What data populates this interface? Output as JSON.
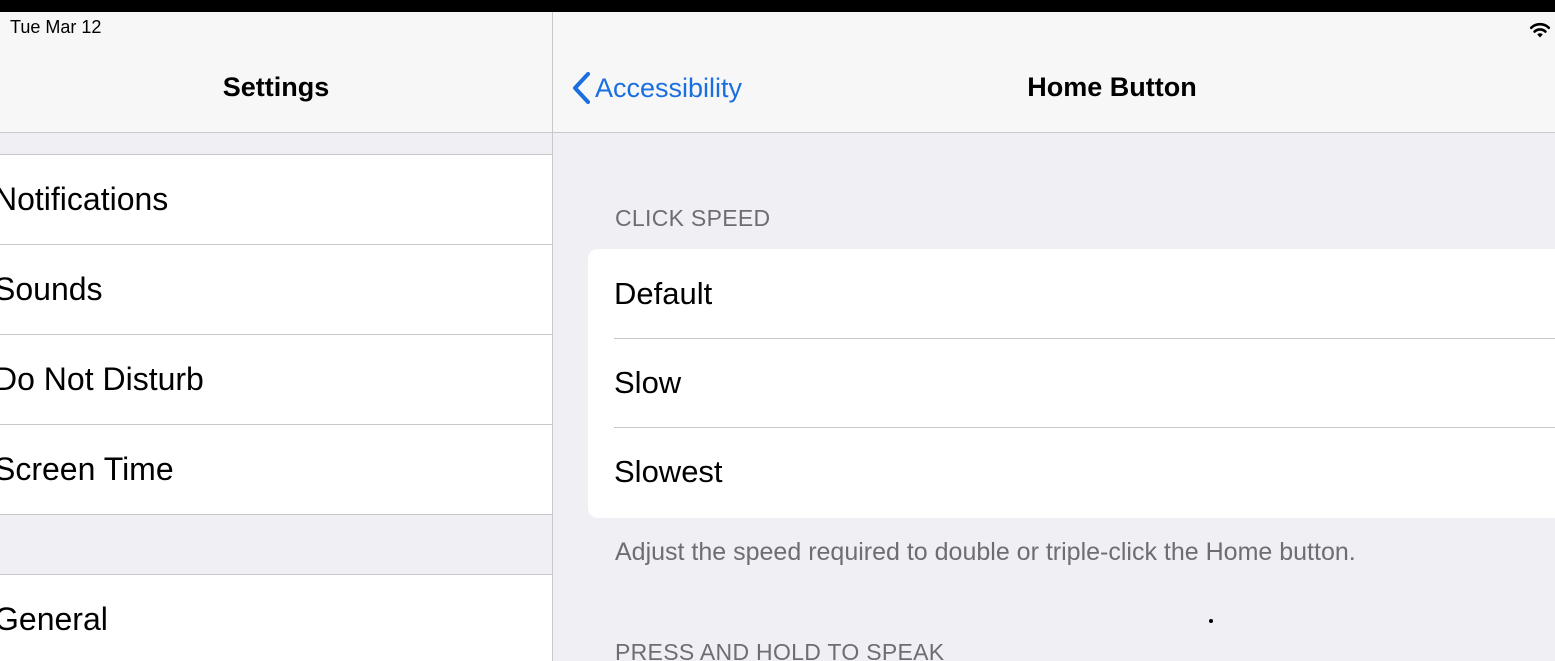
{
  "status_bar": {
    "date": "Tue Mar 12",
    "wifi_icon": "wifi-icon"
  },
  "master": {
    "title": "Settings",
    "group1": [
      {
        "label": "Notifications"
      },
      {
        "label": "Sounds"
      },
      {
        "label": "Do Not Disturb"
      },
      {
        "label": "Screen Time"
      }
    ],
    "group2": [
      {
        "label": "General"
      }
    ]
  },
  "detail": {
    "back_label": "Accessibility",
    "back_icon": "chevron-left-icon",
    "title": "Home Button",
    "click_speed": {
      "header": "CLICK SPEED",
      "options": [
        {
          "label": "Default"
        },
        {
          "label": "Slow"
        },
        {
          "label": "Slowest"
        }
      ],
      "footer": "Adjust the speed required to double or triple-click the Home button."
    },
    "press_and_hold_header": "PRESS AND HOLD TO SPEAK"
  },
  "colors": {
    "accent": "#1a6fe0",
    "background": "#efeff4",
    "separator": "#c8c7cc",
    "secondary_text": "#6d6d72"
  }
}
